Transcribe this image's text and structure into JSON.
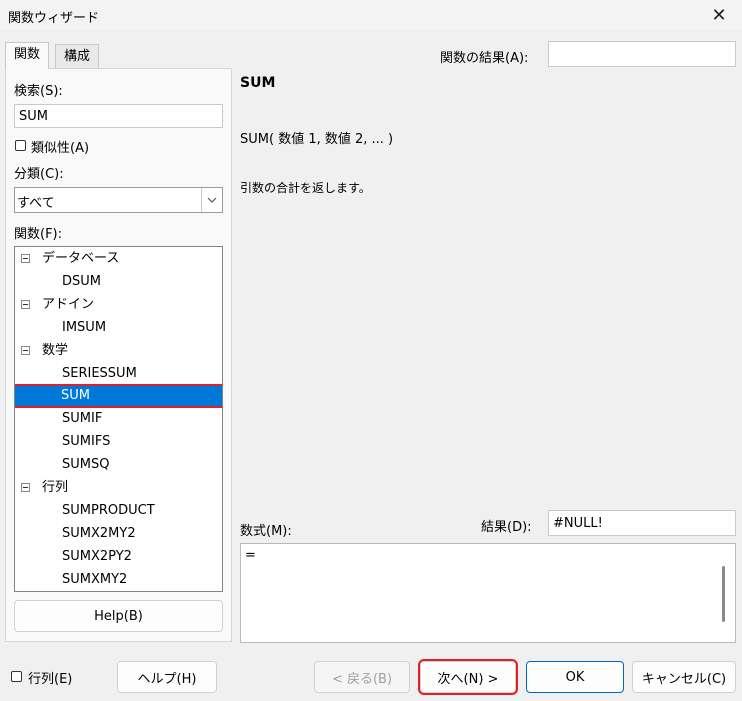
{
  "window": {
    "title": "関数ウィザード",
    "close_label": "✕"
  },
  "tabs": [
    {
      "label": "関数"
    },
    {
      "label": "構成"
    }
  ],
  "left": {
    "search_label": "検索(S):",
    "search_value": "SUM",
    "similarity_label": "類似性(A)",
    "category_label": "分類(C):",
    "category_value": "すべて",
    "functions_label": "関数(F):",
    "help_button": "Help(B)"
  },
  "tree": [
    {
      "type": "cat",
      "label": "データベース"
    },
    {
      "type": "fn",
      "label": "DSUM"
    },
    {
      "type": "cat",
      "label": "アドイン"
    },
    {
      "type": "fn",
      "label": "IMSUM"
    },
    {
      "type": "cat",
      "label": "数学"
    },
    {
      "type": "fn",
      "label": "SERIESSUM"
    },
    {
      "type": "fn",
      "label": "SUM",
      "selected": true
    },
    {
      "type": "fn",
      "label": "SUMIF"
    },
    {
      "type": "fn",
      "label": "SUMIFS"
    },
    {
      "type": "fn",
      "label": "SUMSQ"
    },
    {
      "type": "cat",
      "label": "行列"
    },
    {
      "type": "fn",
      "label": "SUMPRODUCT"
    },
    {
      "type": "fn",
      "label": "SUMX2MY2"
    },
    {
      "type": "fn",
      "label": "SUMX2PY2"
    },
    {
      "type": "fn",
      "label": "SUMXMY2"
    }
  ],
  "right": {
    "function_result_label": "関数の結果(A):",
    "function_result_value": "",
    "name": "SUM",
    "syntax": "SUM( 数値 1, 数値 2, ... )",
    "description": "引数の合計を返します。",
    "formula_label": "数式(M):",
    "result_label": "結果(D):",
    "result_value": "#NULL!",
    "formula_value": "="
  },
  "footer": {
    "array_label": "行列(E)",
    "help_button": "ヘルプ(H)",
    "back_button": "< 戻る(B)",
    "next_button": "次へ(N) >",
    "ok_button": "OK",
    "cancel_button": "キャンセル(C)"
  },
  "colors": {
    "selection": "#0078d7",
    "highlight_frame": "#e0202a"
  }
}
